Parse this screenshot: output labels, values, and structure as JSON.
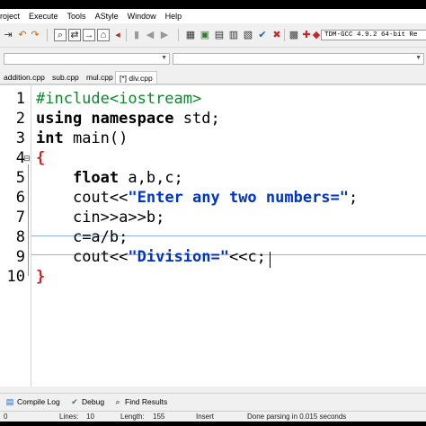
{
  "menu": [
    "roject",
    "Execute",
    "Tools",
    "AStyle",
    "Window",
    "Help"
  ],
  "toolbar": {
    "compiler": "TDM-GCC 4.9.2 64-bit Re",
    "icons": [
      "indent-icon",
      "undo-icon",
      "redo-icon",
      "find-icon",
      "replace-icon",
      "goto-icon",
      "bookmark-icon",
      "back-icon",
      "forward-icon",
      "toggle-icon",
      "left-icon",
      "right-icon",
      "grid-icon",
      "compile-icon",
      "run-icon",
      "compile-run-icon",
      "rebuild-icon",
      "check-icon",
      "stop-icon",
      "chart-icon",
      "debug-icon",
      "profile-icon"
    ]
  },
  "tabs": [
    "addition.cpp",
    "sub.cpp",
    "mul.cpp",
    "[*] div.cpp"
  ],
  "editor": {
    "line_numbers": [
      "1",
      "2",
      "3",
      "4",
      "5",
      "6",
      "7",
      "8",
      "9",
      "10"
    ],
    "lines": [
      {
        "p": "#include<iostream>"
      },
      {
        "k": "using namespace",
        "t": " std;"
      },
      {
        "k": "int",
        "t": " main()"
      },
      {
        "t": "{"
      },
      {
        "i": "    ",
        "k": "float",
        "t": " a,b,c;"
      },
      {
        "i": "    ",
        "t": "cout<<",
        "s": "\"Enter any two numbers=\"",
        "e": ";"
      },
      {
        "i": "    ",
        "t": "cin>>a>>b;"
      },
      {
        "i": "    ",
        "t": "c=a/b;"
      },
      {
        "i": "    ",
        "t": "cout<<",
        "s": "\"Division=\"",
        "e": "<<c;"
      },
      {
        "t": "}"
      }
    ]
  },
  "bottom_tabs": {
    "compile_log": "Compile Log",
    "debug": "Debug",
    "find_results": "Find Results"
  },
  "status": {
    "col": "0",
    "lines_label": "Lines:",
    "lines": "10",
    "length_label": "Length:",
    "length": "155",
    "mode": "Insert",
    "message": "Done parsing in 0.015 seconds"
  }
}
